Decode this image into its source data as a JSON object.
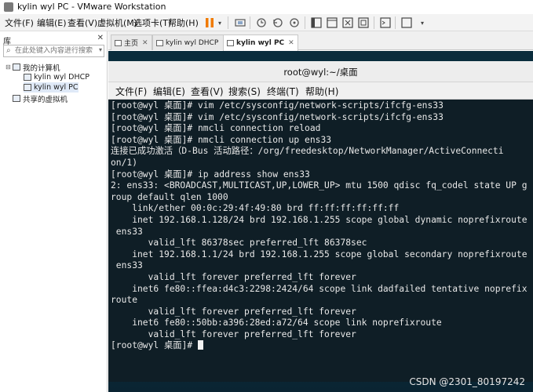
{
  "window": {
    "title": "kylin wyl PC - VMware Workstation"
  },
  "menubar": {
    "items": [
      "文件(F)",
      "编辑(E)",
      "查看(V)",
      "虚拟机(M)",
      "选项卡(T)",
      "帮助(H)"
    ]
  },
  "library": {
    "header": "库",
    "search_placeholder": "在此处键入内容进行搜索",
    "tree": {
      "my_computer": "我的计算机",
      "vm_dhcp": "kylin wyl DHCP",
      "vm_pc": "kylin wyl PC",
      "shared_vms": "共享的虚拟机"
    }
  },
  "tabs": [
    {
      "label": "主页"
    },
    {
      "label": "kylin wyl DHCP"
    },
    {
      "label": "kylin wyl PC"
    }
  ],
  "terminal": {
    "title": "root@wyl:~/桌面",
    "menu": [
      "文件(F)",
      "编辑(E)",
      "查看(V)",
      "搜索(S)",
      "终端(T)",
      "帮助(H)"
    ],
    "lines": [
      "[root@wyl 桌面]# vim /etc/sysconfig/network-scripts/ifcfg-ens33",
      "[root@wyl 桌面]# vim /etc/sysconfig/network-scripts/ifcfg-ens33",
      "[root@wyl 桌面]# nmcli connection reload",
      "[root@wyl 桌面]# nmcli connection up ens33",
      "连接已成功激活（D-Bus 活动路径：/org/freedesktop/NetworkManager/ActiveConnecti",
      "on/1)",
      "[root@wyl 桌面]# ip address show ens33",
      "2: ens33: <BROADCAST,MULTICAST,UP,LOWER_UP> mtu 1500 qdisc fq_codel state UP g",
      "roup default qlen 1000",
      "    link/ether 00:0c:29:4f:49:80 brd ff:ff:ff:ff:ff:ff",
      "    inet 192.168.1.128/24 brd 192.168.1.255 scope global dynamic noprefixroute",
      " ens33",
      "       valid_lft 86378sec preferred_lft 86378sec",
      "    inet 192.168.1.1/24 brd 192.168.1.255 scope global secondary noprefixroute",
      " ens33",
      "       valid_lft forever preferred_lft forever",
      "    inet6 fe80::ffea:d4c3:2298:2424/64 scope link dadfailed tentative noprefix",
      "route",
      "       valid_lft forever preferred_lft forever",
      "    inet6 fe80::50bb:a396:28ed:a72/64 scope link noprefixroute",
      "       valid_lft forever preferred_lft forever"
    ],
    "prompt": "[root@wyl 桌面]# "
  },
  "watermark": "CSDN @2301_80197242",
  "colors": {
    "terminal_bg": "#0f1e26",
    "terminal_text": "#e8e8e8",
    "pause_button": "#f07a00",
    "desktop_bg": "#0d3a48"
  },
  "icons": [
    "pause-icon",
    "dropdown-icon",
    "snapshot-icon",
    "revert-icon",
    "manage-snapshots-icon",
    "library-view-icon",
    "fullscreen-icon",
    "unity-icon",
    "console-view-icon",
    "stretch-icon",
    "close-icon",
    "search-icon",
    "computer-icon",
    "vm-icon",
    "shared-icon",
    "home-icon"
  ]
}
